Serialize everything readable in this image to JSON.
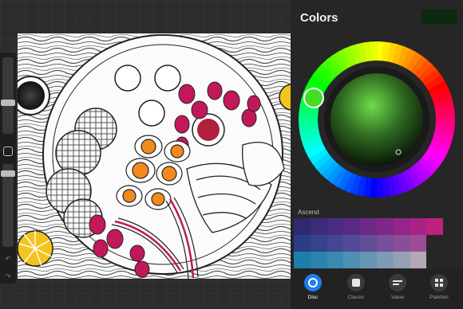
{
  "panel": {
    "title": "Colors",
    "current_color": "#0b2a10",
    "history_label": "Ascend"
  },
  "swatch_rows": [
    [
      "#2d2a6e",
      "#3b2d7a",
      "#4a2c82",
      "#5b2a86",
      "#6d2888",
      "#812789",
      "#952588",
      "#a92386",
      "#bd2080"
    ],
    [
      "#2b3d86",
      "#35428c",
      "#434792",
      "#534b96",
      "#644e98",
      "#774e99",
      "#8a4d98",
      "#9d4b96"
    ],
    [
      "#1d7ea8",
      "#2983ac",
      "#3a8aaf",
      "#4f90b2",
      "#6596b4",
      "#7d9bb6",
      "#95a0b6",
      "#b3a7b8"
    ]
  ],
  "tabs": [
    {
      "label": "Disc",
      "icon": "disc-icon",
      "active": true
    },
    {
      "label": "Classic",
      "icon": "classic-icon",
      "active": false
    },
    {
      "label": "Value",
      "icon": "value-icon",
      "active": false
    },
    {
      "label": "Palettes",
      "icon": "palettes-icon",
      "active": false
    }
  ],
  "colors": {
    "accent": "#1d7df2",
    "panel_bg": "#262626",
    "selected_hue": "#44dd22"
  }
}
